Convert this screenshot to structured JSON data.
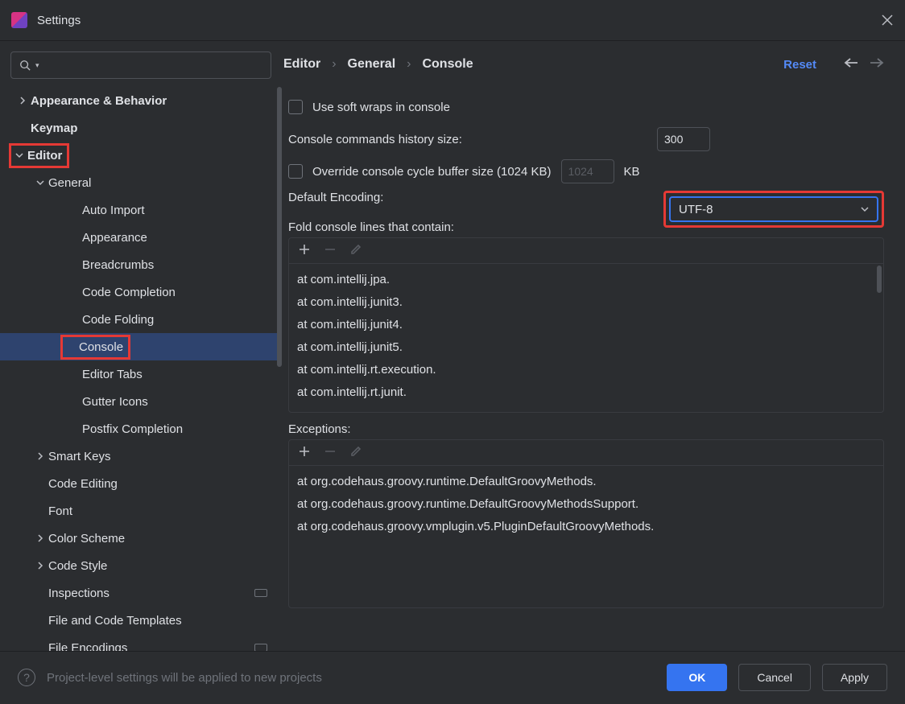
{
  "window": {
    "title": "Settings"
  },
  "breadcrumbs": [
    "Editor",
    "General",
    "Console"
  ],
  "actions": {
    "reset": "Reset"
  },
  "tree": [
    {
      "depth": 0,
      "label": "Appearance & Behavior",
      "bold": true,
      "arrow": "right"
    },
    {
      "depth": 0,
      "label": "Keymap",
      "bold": true
    },
    {
      "depth": 0,
      "label": "Editor",
      "bold": true,
      "arrow": "down",
      "highlight": true
    },
    {
      "depth": 1,
      "label": "General",
      "arrow": "down"
    },
    {
      "depth": 2,
      "label": "Auto Import"
    },
    {
      "depth": 2,
      "label": "Appearance"
    },
    {
      "depth": 2,
      "label": "Breadcrumbs"
    },
    {
      "depth": 2,
      "label": "Code Completion"
    },
    {
      "depth": 2,
      "label": "Code Folding"
    },
    {
      "depth": 2,
      "label": "Console",
      "selected": true,
      "highlight": true
    },
    {
      "depth": 2,
      "label": "Editor Tabs"
    },
    {
      "depth": 2,
      "label": "Gutter Icons"
    },
    {
      "depth": 2,
      "label": "Postfix Completion"
    },
    {
      "depth": 1,
      "label": "Smart Keys",
      "arrow": "right"
    },
    {
      "depth": 1,
      "label": "Code Editing"
    },
    {
      "depth": 1,
      "label": "Font"
    },
    {
      "depth": 1,
      "label": "Color Scheme",
      "arrow": "right"
    },
    {
      "depth": 1,
      "label": "Code Style",
      "arrow": "right"
    },
    {
      "depth": 1,
      "label": "Inspections",
      "badge": true
    },
    {
      "depth": 1,
      "label": "File and Code Templates"
    },
    {
      "depth": 1,
      "label": "File Encodings",
      "badge": true
    }
  ],
  "settings": {
    "soft_wraps": "Use soft wraps in console",
    "history_label": "Console commands history size:",
    "history_value": "300",
    "override_label": "Override console cycle buffer size (1024 KB)",
    "override_value": "1024",
    "override_unit": "KB",
    "encoding_label": "Default Encoding:",
    "encoding_value": "UTF-8",
    "fold_label": "Fold console lines that contain:",
    "fold_items": [
      "at com.intellij.jpa.",
      "at com.intellij.junit3.",
      "at com.intellij.junit4.",
      "at com.intellij.junit5.",
      "at com.intellij.rt.execution.",
      "at com.intellij.rt.junit."
    ],
    "exceptions_label": "Exceptions:",
    "exceptions_items": [
      "at org.codehaus.groovy.runtime.DefaultGroovyMethods.",
      "at org.codehaus.groovy.runtime.DefaultGroovyMethodsSupport.",
      "at org.codehaus.groovy.vmplugin.v5.PluginDefaultGroovyMethods."
    ]
  },
  "footer": {
    "hint": "Project-level settings will be applied to new projects",
    "ok": "OK",
    "cancel": "Cancel",
    "apply": "Apply"
  }
}
